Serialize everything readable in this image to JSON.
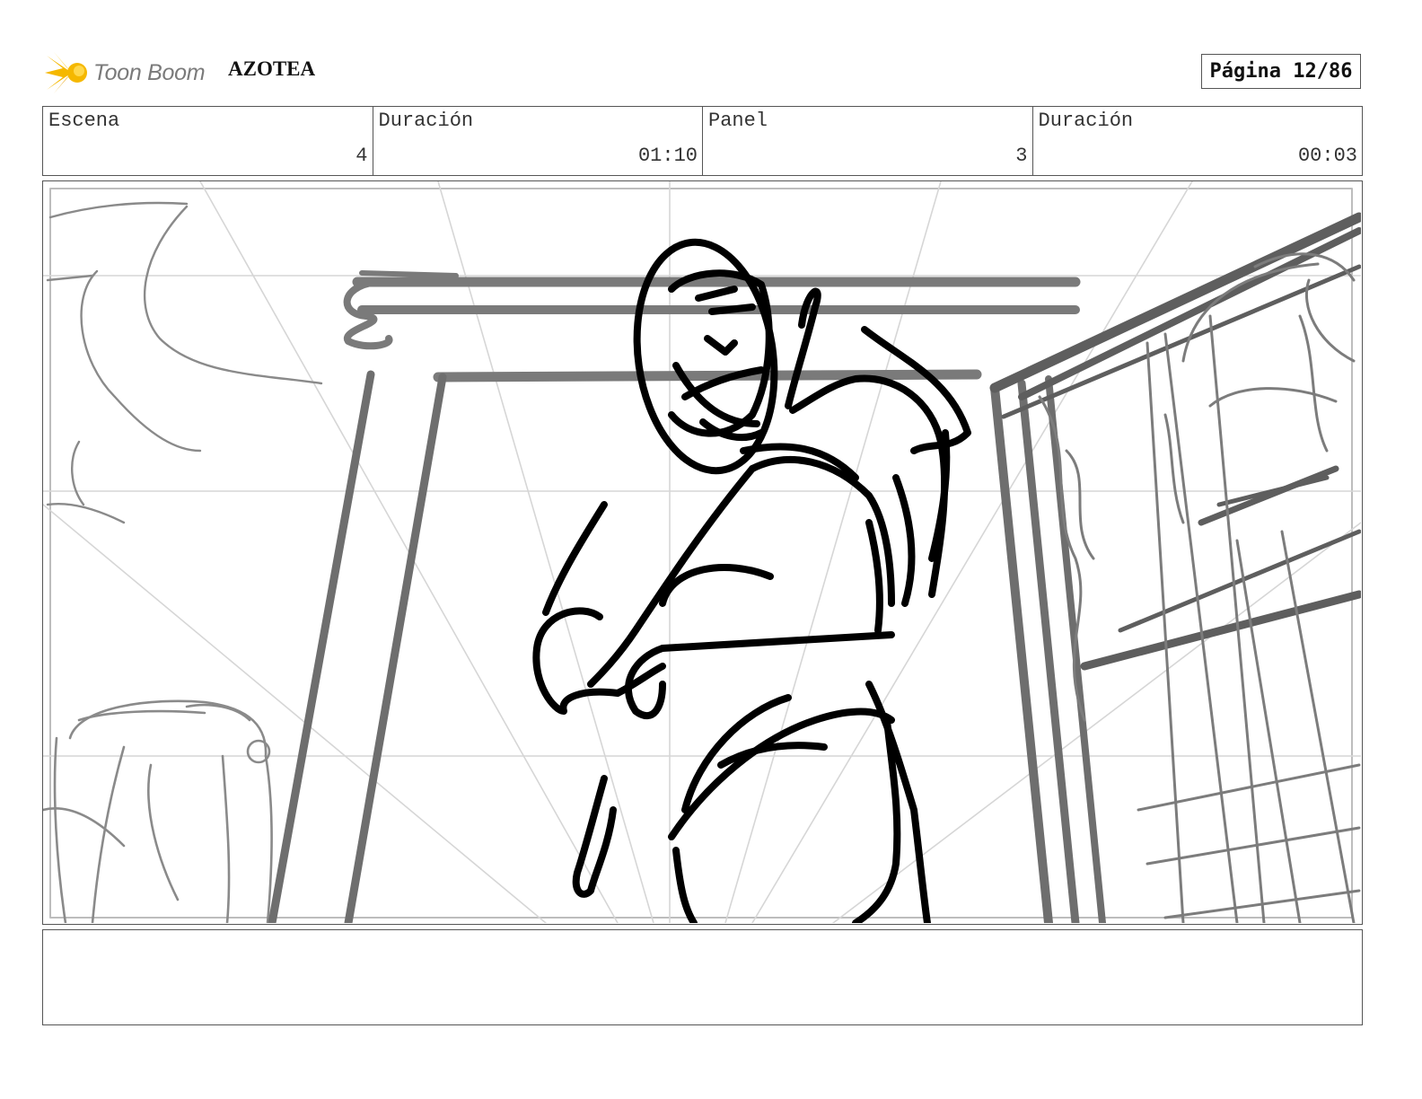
{
  "header": {
    "logo_text": "Toon Boom",
    "project_title": "AZOTEA",
    "page_label": "Página 12/86"
  },
  "info": [
    {
      "label": "Escena",
      "value": "4"
    },
    {
      "label": "Duración",
      "value": "01:10"
    },
    {
      "label": "Panel",
      "value": "3"
    },
    {
      "label": "Duración",
      "value": "00:03"
    }
  ],
  "notes": {
    "text": ""
  },
  "colors": {
    "logo_accent": "#f5b800",
    "sketch_line": "#000000",
    "structure_line": "#6e6e6e",
    "guide_line": "#d4d4d4"
  }
}
